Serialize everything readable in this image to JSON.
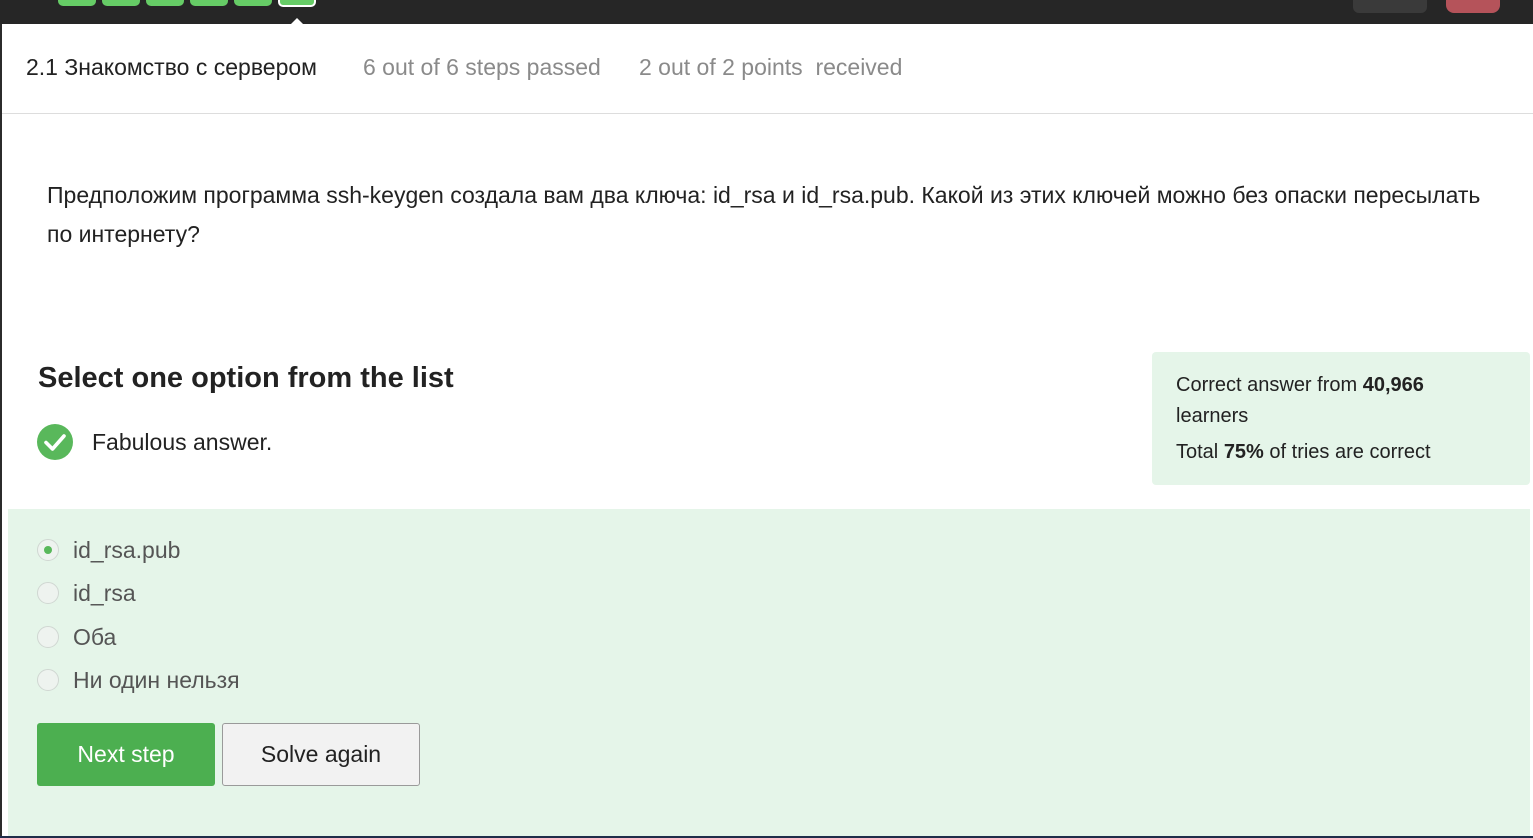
{
  "header": {
    "lesson_title": "2.1 Знакомство с сервером",
    "steps_passed": "6 out of 6 steps passed",
    "points": "2 out of 2 points  received"
  },
  "question": {
    "text": "Предположим программа ssh-keygen создала вам два ключа: id_rsa и id_rsa.pub. Какой из этих ключей можно без опаски пересылать по интернету?"
  },
  "quiz": {
    "instruction": "Select one option from the list",
    "feedback": "Fabulous answer.",
    "options": [
      {
        "label": "id_rsa.pub",
        "selected": true
      },
      {
        "label": "id_rsa",
        "selected": false
      },
      {
        "label": "Оба",
        "selected": false
      },
      {
        "label": "Ни один нельзя",
        "selected": false
      }
    ],
    "next_label": "Next step",
    "again_label": "Solve again"
  },
  "stats": {
    "prefix": "Correct answer from",
    "learners_count": "40,966",
    "learners_word": "learners",
    "total_prefix": "Total",
    "percent": "75%",
    "total_suffix": "of tries are correct"
  },
  "colors": {
    "accent_green": "#4caf50",
    "success_bg": "#e5f5e9",
    "topbar": "#262626"
  }
}
